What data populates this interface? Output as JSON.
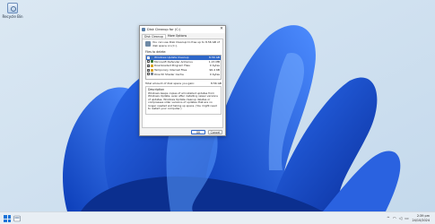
{
  "desktop": {
    "icon_label": "Recycle Bin"
  },
  "dialog": {
    "title": "Disk Cleanup for (C:)",
    "tabs": [
      "Disk Cleanup",
      "More Options"
    ],
    "intro": "You can use Disk Cleanup to free up to 8.56 GB of disk space on (C:).",
    "files_label": "Files to delete:",
    "files": [
      {
        "name": "Windows Update Cleanup",
        "size": "8.56 GB",
        "checked": true,
        "selected": true,
        "color": "#3a6fb8"
      },
      {
        "name": "Microsoft Defender Antivirus",
        "size": "1.15 MB",
        "checked": false,
        "selected": false,
        "color": "#3d7d3a"
      },
      {
        "name": "Downloaded Program Files",
        "size": "0 bytes",
        "checked": true,
        "selected": false,
        "color": "#d9a322"
      },
      {
        "name": "Temporary Internet Files",
        "size": "96.4 KB",
        "checked": true,
        "selected": false,
        "color": "#d9a322"
      },
      {
        "name": "DirectX Shader Cache",
        "size": "0 bytes",
        "checked": false,
        "selected": false,
        "color": "#7b8794"
      }
    ],
    "total_label": "Total amount of disk space you gain:",
    "total_value": "8.56 GB",
    "description_legend": "Description",
    "description": "Windows keeps copies of all installed updates from Windows Update, even after installing newer versions of updates. Windows Update cleanup deletes or compresses older versions of updates that are no longer needed and taking up space. (You might need to restart your computer.)",
    "ok_label": "OK",
    "cancel_label": "Cancel"
  },
  "taskbar": {
    "tray_icons": [
      "chevron-up-icon",
      "network-icon",
      "volume-icon",
      "battery-icon"
    ],
    "time": "2:39 pm",
    "date": "24/10/2024"
  },
  "colors": {
    "accent": "#1a73d8",
    "selection": "#2d66c8"
  }
}
